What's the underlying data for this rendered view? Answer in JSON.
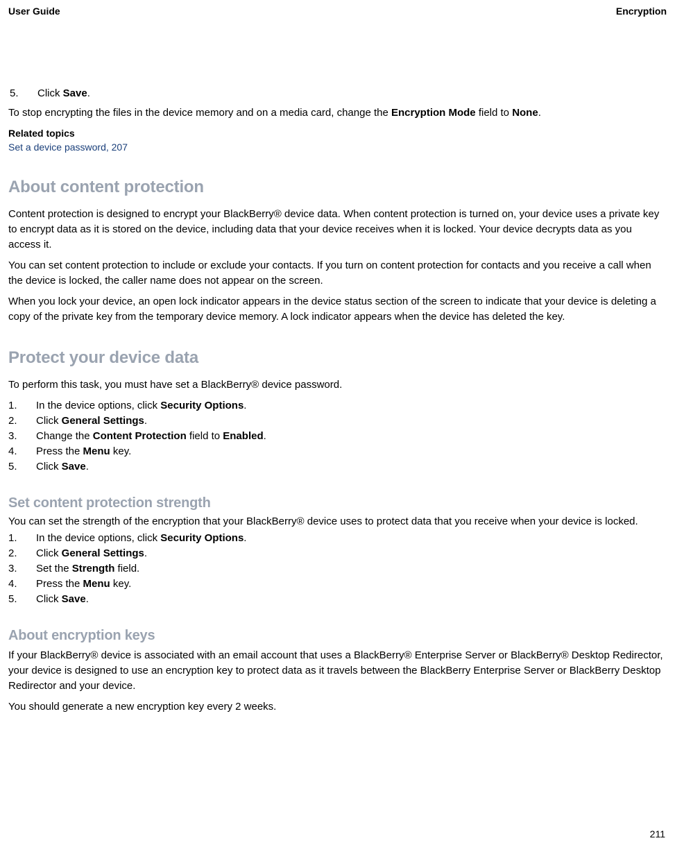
{
  "header": {
    "left": "User Guide",
    "right": "Encryption"
  },
  "intro": {
    "step5_num": "5.",
    "step5_prefix": "Click ",
    "step5_bold": "Save",
    "step5_suffix": ".",
    "stopEncrypt_prefix": "To stop encrypting the files in the device memory and on a media card, change the ",
    "bold_encMode": "Encryption Mode",
    "stopEncrypt_mid": " field to ",
    "bold_none": "None",
    "stopEncrypt_suffix": ".",
    "relatedTopicsLabel": "Related topics",
    "relatedLink": "Set a device password, 207"
  },
  "aboutContentProtection": {
    "title": "About content protection",
    "p1": "Content protection is designed to encrypt your BlackBerry® device data. When content protection is turned on, your device uses a private key to encrypt data as it is stored on the device, including data that your device receives when it is locked. Your device decrypts data as you access it.",
    "p2": "You can set content protection to include or exclude your contacts. If you turn on content protection for contacts and you receive a call when the device is locked, the caller name does not appear on the screen.",
    "p3": "When you lock your device, an open lock indicator appears in the device status section of the screen to indicate that your device is deleting a copy of the private key from the temporary device memory. A lock indicator appears when the device has deleted the key."
  },
  "protectDeviceData": {
    "title": "Protect your device data",
    "intro": "To perform this task, you must have set a BlackBerry® device password.",
    "steps": [
      {
        "num": "1.",
        "prefix": "In the device options, click ",
        "bold": "Security Options",
        "suffix": "."
      },
      {
        "num": "2.",
        "prefix": "Click ",
        "bold": "General Settings",
        "suffix": "."
      },
      {
        "num": "3.",
        "prefix": "Change the ",
        "bold": "Content Protection",
        "mid": " field to ",
        "bold2": "Enabled",
        "suffix": "."
      },
      {
        "num": "4.",
        "prefix": "Press the ",
        "bold": "Menu",
        "suffix": " key."
      },
      {
        "num": "5.",
        "prefix": "Click ",
        "bold": "Save",
        "suffix": "."
      }
    ]
  },
  "setStrength": {
    "title": "Set content protection strength",
    "intro": "You can set the strength of the encryption that your BlackBerry® device uses to protect data that you receive when your device is locked.",
    "steps": [
      {
        "num": "1.",
        "prefix": "In the device options, click ",
        "bold": "Security Options",
        "suffix": "."
      },
      {
        "num": "2.",
        "prefix": "Click ",
        "bold": "General Settings",
        "suffix": "."
      },
      {
        "num": "3.",
        "prefix": "Set the ",
        "bold": "Strength",
        "suffix": " field."
      },
      {
        "num": "4.",
        "prefix": "Press the ",
        "bold": "Menu",
        "suffix": " key."
      },
      {
        "num": "5.",
        "prefix": "Click ",
        "bold": "Save",
        "suffix": "."
      }
    ]
  },
  "aboutKeys": {
    "title": "About encryption keys",
    "p1": "If your BlackBerry® device is associated with an email account that uses a BlackBerry® Enterprise Server or BlackBerry® Desktop Redirector, your device is designed to use an encryption key to protect data as it travels between the BlackBerry Enterprise Server or BlackBerry Desktop Redirector and your device.",
    "p2": "You should generate a new encryption key every 2 weeks."
  },
  "pageNumber": "211"
}
